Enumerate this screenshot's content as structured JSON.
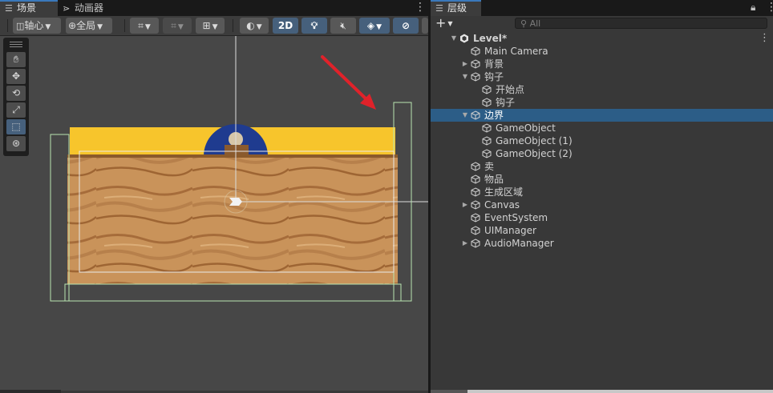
{
  "scene_tab": {
    "icon": "grid-icon",
    "label": "场景"
  },
  "animator_tab": {
    "icon": "animator-icon",
    "label": "动画器"
  },
  "hierarchy_tab": {
    "icon": "list-icon",
    "label": "层级"
  },
  "scene_toolbar": {
    "pivot_label": "轴心",
    "global_label": "全局",
    "mode_2d_label": "2D"
  },
  "hierarchy": {
    "add_label": "+",
    "search_placeholder": "All",
    "items": [
      {
        "label": "Level*",
        "depth": 0,
        "expanded": true,
        "scene": true
      },
      {
        "label": "Main Camera",
        "depth": 1
      },
      {
        "label": "背景",
        "depth": 1,
        "collapsed": true
      },
      {
        "label": "钩子",
        "depth": 1,
        "expanded": true
      },
      {
        "label": "开始点",
        "depth": 2
      },
      {
        "label": "钩子",
        "depth": 2
      },
      {
        "label": "边界",
        "depth": 1,
        "expanded": true,
        "selected": true
      },
      {
        "label": "GameObject",
        "depth": 2
      },
      {
        "label": "GameObject (1)",
        "depth": 2
      },
      {
        "label": "GameObject (2)",
        "depth": 2
      },
      {
        "label": "卖",
        "depth": 1
      },
      {
        "label": "物品",
        "depth": 1
      },
      {
        "label": "生成区域",
        "depth": 1
      },
      {
        "label": "Canvas",
        "depth": 1,
        "collapsed": true
      },
      {
        "label": "EventSystem",
        "depth": 1
      },
      {
        "label": "UIManager",
        "depth": 1
      },
      {
        "label": "AudioManager",
        "depth": 1,
        "collapsed": true
      }
    ]
  },
  "colors": {
    "selection": "#2c5d87",
    "accent_blue": "#46607c",
    "annotation_arrow": "#e0222a",
    "bounds_outline": "#b9e6b0",
    "sky_yellow": "#f7c52c",
    "sand": "#c9935a"
  }
}
